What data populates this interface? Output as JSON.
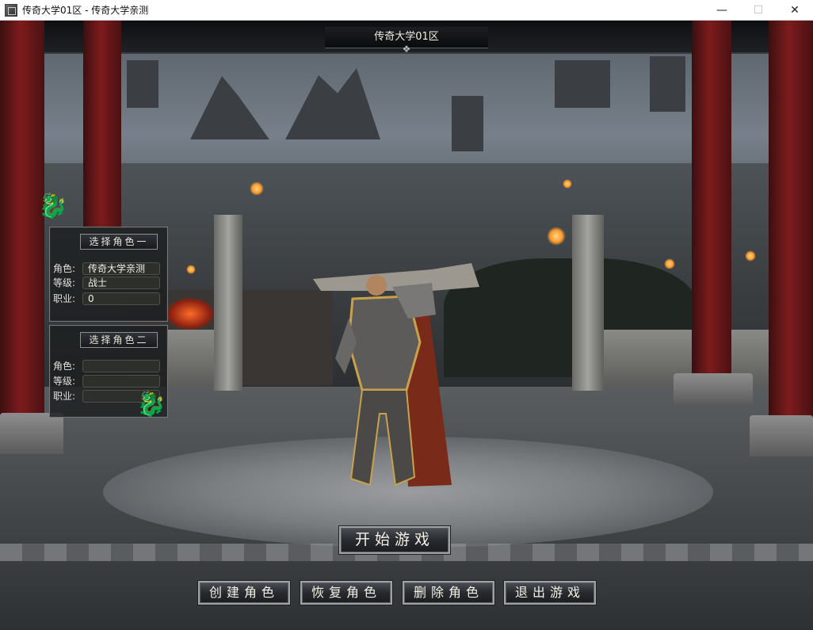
{
  "window": {
    "title": "传奇大学01区 - 传奇大学亲测",
    "controls": {
      "minimize": "—",
      "maximize": "☐",
      "close": "✕"
    }
  },
  "server": {
    "name": "传奇大学01区"
  },
  "role_slots": [
    {
      "select_label": "选择角色一",
      "fields": [
        {
          "label": "角色:",
          "value": "传奇大学亲测"
        },
        {
          "label": "等级:",
          "value": "战士"
        },
        {
          "label": "职业:",
          "value": "0"
        }
      ]
    },
    {
      "select_label": "选择角色二",
      "fields": [
        {
          "label": "角色:",
          "value": ""
        },
        {
          "label": "等级:",
          "value": ""
        },
        {
          "label": "职业:",
          "value": ""
        }
      ]
    }
  ],
  "buttons": {
    "start": "开始游戏",
    "create": "创建角色",
    "restore": "恢复角色",
    "delete": "删除角色",
    "exit": "退出游戏"
  },
  "icons": {
    "app": "app-icon",
    "dragon_ornament": "dragon-icon",
    "banner_ornament": "ornament-icon"
  }
}
